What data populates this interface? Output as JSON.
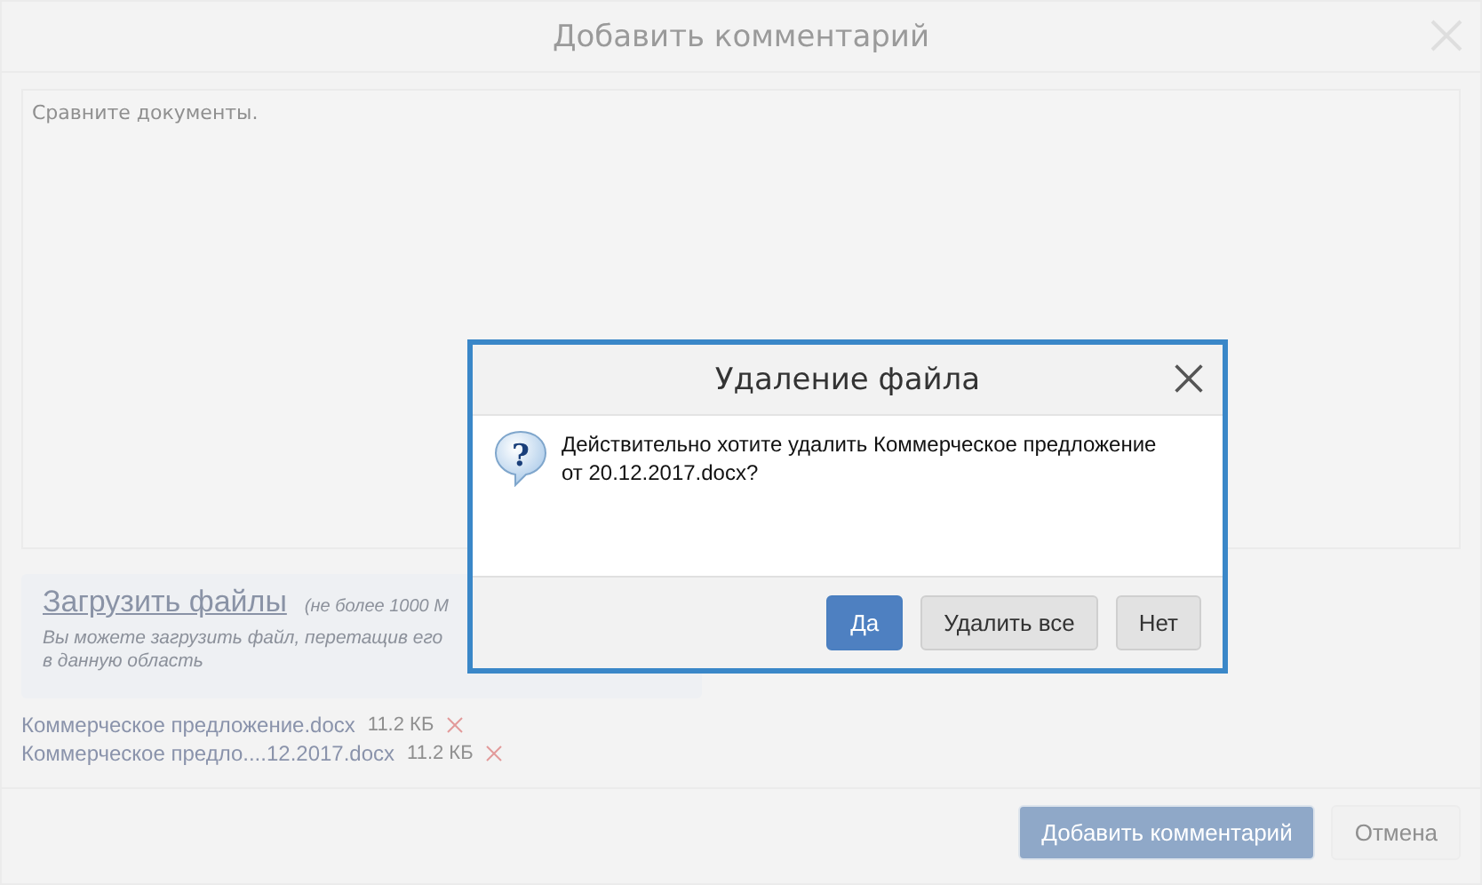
{
  "dialog": {
    "title": "Добавить комментарий",
    "comment": "Сравните документы.",
    "upload": {
      "link": "Загрузить файлы",
      "limit": "(не более 1000 М",
      "hint_lines": [
        "Вы можете загрузить файл, перетащив его",
        "в данную область"
      ]
    },
    "files": [
      {
        "name": "Коммерческое предложение.docx",
        "size": "11.2 КБ"
      },
      {
        "name": "Коммерческое предло....12.2017.docx",
        "size": "11.2 КБ"
      }
    ],
    "buttons": [
      {
        "label": "Добавить комментарий",
        "kind": "primary"
      },
      {
        "label": "Отмена",
        "kind": "default"
      }
    ]
  },
  "confirm": {
    "title": "Удаление файла",
    "icon_glyph": "?",
    "message": "Действительно хотите удалить Коммерческое предложение от 20.12.2017.docx?",
    "buttons": [
      {
        "label": "Да",
        "kind": "primary"
      },
      {
        "label": "Удалить все",
        "kind": "default"
      },
      {
        "label": "Нет",
        "kind": "default"
      }
    ]
  }
}
